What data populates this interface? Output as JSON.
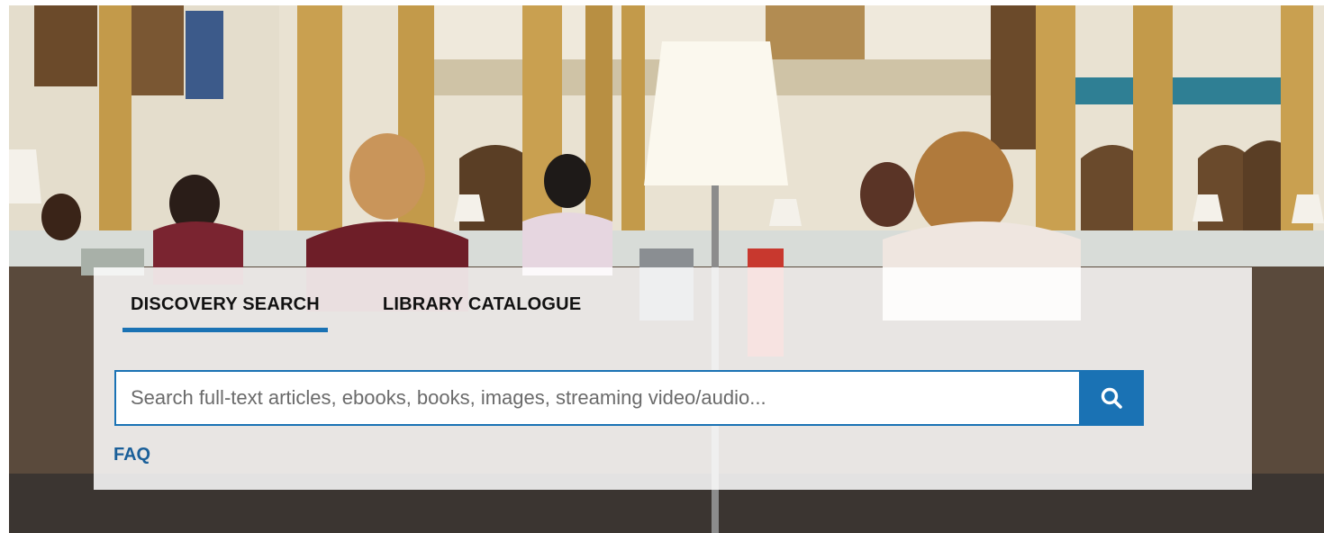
{
  "hero": {
    "image_description_icon": "library-reading-room-photo"
  },
  "tabs": [
    {
      "label": "DISCOVERY SEARCH",
      "active": true
    },
    {
      "label": "LIBRARY CATALOGUE",
      "active": false
    }
  ],
  "search": {
    "placeholder": "Search full-text articles, ebooks, books, images, streaming video/audio...",
    "value": "",
    "button_icon": "search-icon"
  },
  "links": {
    "faq_label": "FAQ"
  },
  "colors": {
    "accent": "#1a72b4",
    "link": "#1a5f99",
    "tab_text": "#111111"
  }
}
